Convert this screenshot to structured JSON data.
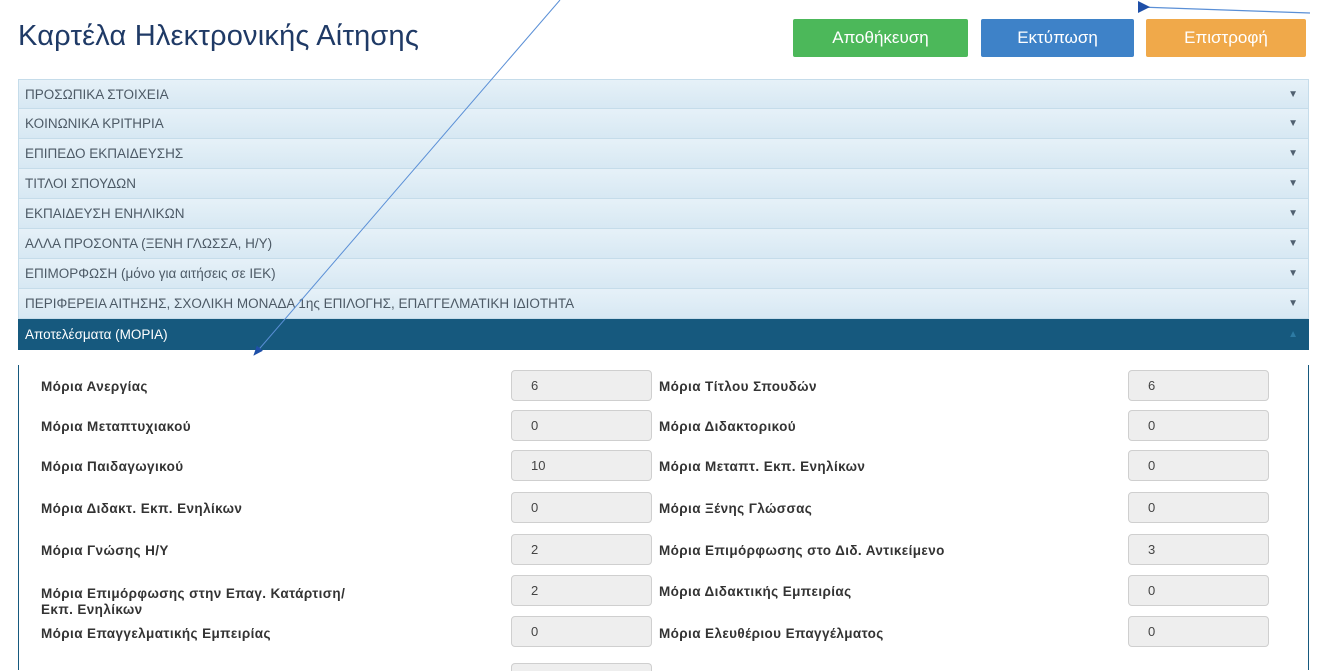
{
  "header": {
    "title": "Καρτέλα Ηλεκτρονικής Αίτησης",
    "save_label": "Αποθήκευση",
    "print_label": "Εκτύπωση",
    "back_label": "Επιστροφή"
  },
  "sections": [
    {
      "label": "ΠΡΟΣΩΠΙΚΑ ΣΤΟΙΧΕΙΑ"
    },
    {
      "label": "ΚΟΙΝΩΝΙΚΑ ΚΡΙΤΗΡΙΑ"
    },
    {
      "label": "ΕΠΙΠΕΔΟ ΕΚΠΑΙΔΕΥΣΗΣ"
    },
    {
      "label": "ΤΙΤΛΟΙ ΣΠΟΥΔΩΝ"
    },
    {
      "label": "ΕΚΠΑΙΔΕΥΣΗ ΕΝΗΛΙΚΩΝ"
    },
    {
      "label": "ΑΛΛΑ ΠΡΟΣΟΝΤΑ (ΞΕΝΗ ΓΛΩΣΣΑ, Η/Υ)"
    },
    {
      "label": "ΕΠΙΜΟΡΦΩΣΗ (μόνο για αιτήσεις σε ΙΕΚ)"
    },
    {
      "label": "ΠΕΡΙΦΕΡΕΙΑ ΑΙΤΗΣΗΣ, ΣΧΟΛΙΚΗ ΜΟΝΑΔΑ 1ης ΕΠΙΛΟΓΗΣ, ΕΠΑΓΓΕΛΜΑΤΙΚΗ ΙΔΙΟΤΗΤΑ"
    },
    {
      "label": "Αποτελέσματα (ΜΟΡΙΑ)"
    }
  ],
  "results": {
    "left": [
      {
        "label": "Μόρια Ανεργίας",
        "value": "6"
      },
      {
        "label": "Μόρια Μεταπτυχιακού",
        "value": "0"
      },
      {
        "label": "Μόρια Παιδαγωγικού",
        "value": "10"
      },
      {
        "label": "Μόρια Διδακτ. Εκπ. Ενηλίκων",
        "value": "0"
      },
      {
        "label": "Μόρια Γνώσης Η/Υ",
        "value": "2"
      },
      {
        "label": "Μόρια Επιμόρφωσης στην Επαγ. Κατάρτιση/",
        "label2": "Εκπ. Ενηλίκων",
        "value": "2"
      },
      {
        "label": "Μόρια Επαγγελματικής Εμπειρίας",
        "value": "0"
      }
    ],
    "right": [
      {
        "label": "Μόρια Τίτλου Σπουδών",
        "value": "6"
      },
      {
        "label": "Μόρια Διδακτορικού",
        "value": "0"
      },
      {
        "label": "Μόρια Μεταπτ. Εκπ. Ενηλίκων",
        "value": "0"
      },
      {
        "label": "Μόρια Ξένης Γλώσσας",
        "value": "0"
      },
      {
        "label": "Μόρια Επιμόρφωσης στο Διδ. Αντικείμενο",
        "value": "3"
      },
      {
        "label": "Μόρια Διδακτικής Εμπειρίας",
        "value": "0"
      },
      {
        "label": "Μόρια Ελευθέριου Επαγγέλματος",
        "value": "0"
      }
    ]
  },
  "colors": {
    "save": "#4cb85a",
    "print": "#3e82c8",
    "back": "#f0a94a",
    "active_section": "#16597e",
    "title": "#1f3a66"
  }
}
